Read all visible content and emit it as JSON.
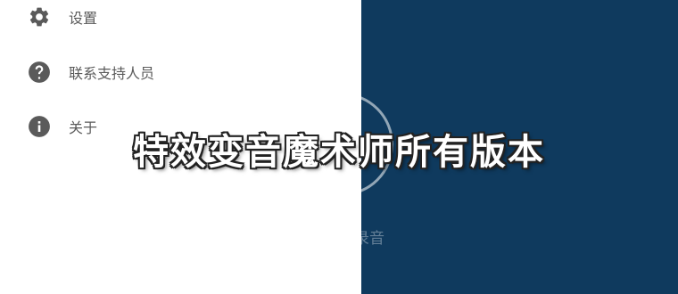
{
  "drawer": {
    "items": [
      {
        "label": "设置",
        "icon": "gear-icon"
      },
      {
        "label": "联系支持人员",
        "icon": "help-circle-icon"
      },
      {
        "label": "关于",
        "icon": "info-icon"
      }
    ]
  },
  "main": {
    "record_label": "录音"
  },
  "overlay": {
    "title": "特效变音魔术师所有版本"
  },
  "colors": {
    "content_background": "#0f3a5e",
    "drawer_background": "#ffffff",
    "icon": "#5a5a5a",
    "label": "#5b5b5b"
  }
}
